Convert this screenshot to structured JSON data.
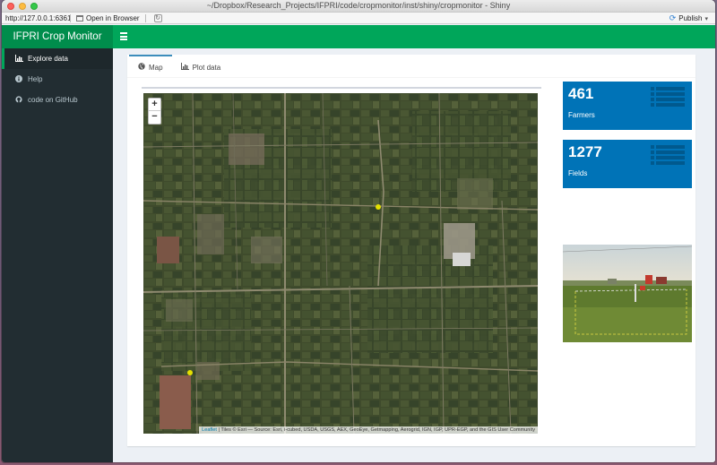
{
  "window": {
    "title": "~/Dropbox/Research_Projects/IFPRI/code/cropmonitor/inst/shiny/cropmonitor - Shiny"
  },
  "toolbar": {
    "url": "http://127.0.0.1:6361",
    "open_browser_label": "Open in Browser",
    "publish_label": "Publish"
  },
  "app": {
    "title": "IFPRI Crop Monitor",
    "header_color": "#00a65a",
    "logo_color": "#008d4c"
  },
  "sidebar": {
    "items": [
      {
        "label": "Explore data",
        "icon": "bar-chart-icon",
        "active": true
      },
      {
        "label": "Help",
        "icon": "info-icon",
        "active": false
      },
      {
        "label": "code on GitHub",
        "icon": "github-icon",
        "active": false
      }
    ]
  },
  "tabs": [
    {
      "label": "Map",
      "icon": "globe-icon",
      "active": true
    },
    {
      "label": "Plot data",
      "icon": "bar-chart-icon",
      "active": false
    }
  ],
  "map": {
    "zoom_in": "+",
    "zoom_out": "−",
    "attribution_link": "Leaflet",
    "attribution_text": " | Tiles © Esri — Source: Esri, i-cubed, USDA, USGS, AEX, GeoEye, Getmapping, Aerogrid, IGN, IGP, UPR-EGP, and the GIS User Community"
  },
  "value_boxes": [
    {
      "value": "461",
      "label": "Farmers",
      "color": "#0073b7"
    },
    {
      "value": "1277",
      "label": "Fields",
      "color": "#0073b7"
    }
  ]
}
